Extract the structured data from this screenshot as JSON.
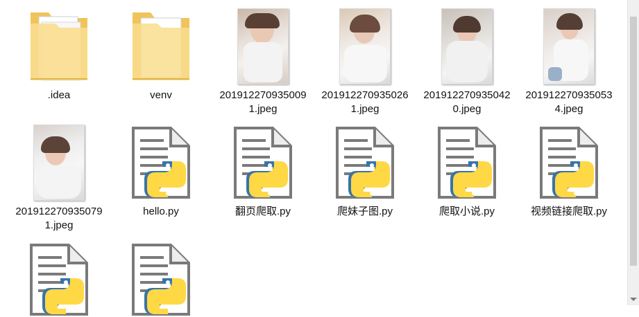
{
  "files": [
    {
      "name": ".idea",
      "type": "folder"
    },
    {
      "name": "venv",
      "type": "folder"
    },
    {
      "name": "2019122709350091.jpeg",
      "type": "image"
    },
    {
      "name": "2019122709350261.jpeg",
      "type": "image"
    },
    {
      "name": "2019122709350420.jpeg",
      "type": "image"
    },
    {
      "name": "2019122709350534.jpeg",
      "type": "image"
    },
    {
      "name": "2019122709350791.jpeg",
      "type": "image"
    },
    {
      "name": "hello.py",
      "type": "python"
    },
    {
      "name": "翻页爬取.py",
      "type": "python"
    },
    {
      "name": "爬妹子图.py",
      "type": "python"
    },
    {
      "name": "爬取小说.py",
      "type": "python"
    },
    {
      "name": "视频链接爬取.py",
      "type": "python"
    },
    {
      "name": "",
      "type": "python"
    },
    {
      "name": "",
      "type": "python"
    }
  ],
  "colors": {
    "folder": "#f5d37a",
    "python_blue": "#3774a8",
    "python_yellow": "#ffd845",
    "doc_gray": "#7a7a7a"
  }
}
